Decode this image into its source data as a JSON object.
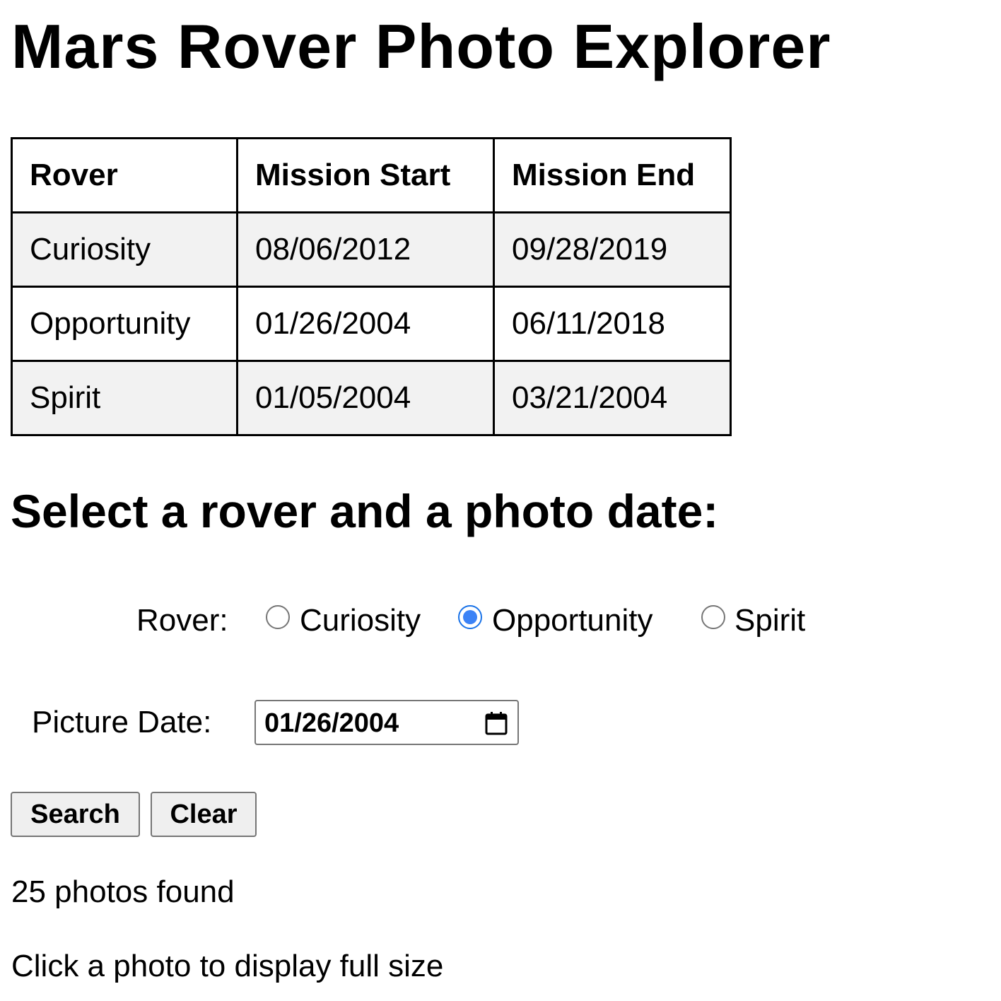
{
  "page": {
    "title": "Mars Rover Photo Explorer",
    "subtitle": "Select a rover and a photo date:"
  },
  "missions_table": {
    "headers": [
      "Rover",
      "Mission Start",
      "Mission End"
    ],
    "rows": [
      [
        "Curiosity",
        "08/06/2012",
        "09/28/2019"
      ],
      [
        "Opportunity",
        "01/26/2004",
        "06/11/2018"
      ],
      [
        "Spirit",
        "01/05/2004",
        "03/21/2004"
      ]
    ]
  },
  "form": {
    "rover_label": "Rover:",
    "rover_options": [
      "Curiosity",
      "Opportunity",
      "Spirit"
    ],
    "selected_rover": "Opportunity",
    "date_label": "Picture Date:",
    "date_value": "01/26/2004",
    "search_label": "Search",
    "clear_label": "Clear"
  },
  "results": {
    "count_text": "25 photos found",
    "hint_text": "Click a photo to display full size"
  },
  "colors": {
    "radio_checked": "#3b82f6",
    "row_shade": "#f2f2f2",
    "button_bg": "#efefef"
  },
  "icons": {
    "date_picker": "calendar-icon"
  }
}
